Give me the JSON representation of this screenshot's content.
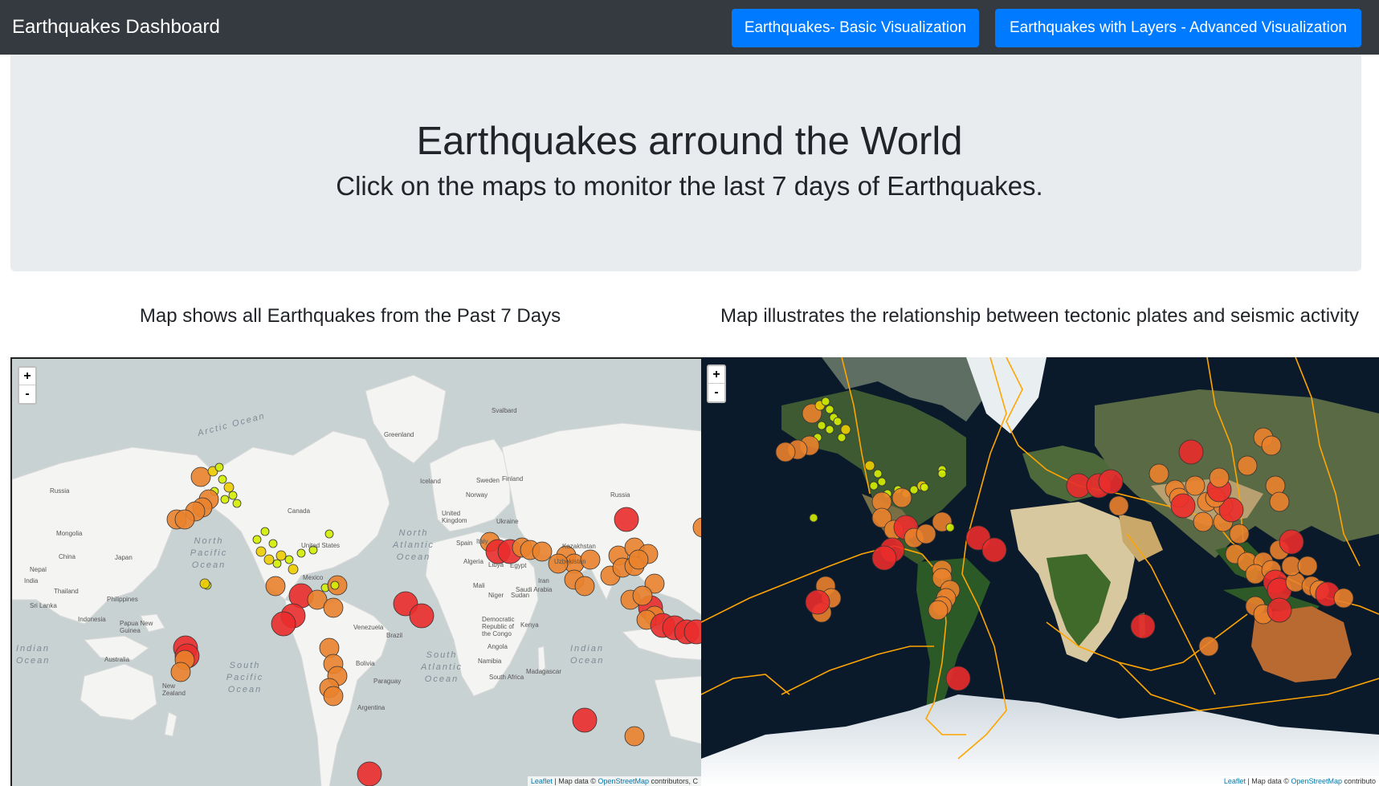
{
  "navbar": {
    "brand": "Earthquakes Dashboard",
    "buttons": [
      {
        "label": "Earthquakes- Basic Visualization"
      },
      {
        "label": "Earthquakes with Layers - Advanced Visualization"
      }
    ]
  },
  "hero": {
    "title": "Earthquakes arround the World",
    "subtitle": "Click on the maps to monitor the last 7 days of Earthquakes."
  },
  "maps": [
    {
      "caption": "Map shows all Earthquakes from the Past 7 Days",
      "zoom_in": "+",
      "zoom_out": "-",
      "attribution": {
        "leaflet": "Leaflet",
        "sep": " | Map data © ",
        "osm": "OpenStreetMap",
        "tail": " contributors, C"
      },
      "ocean_labels": [
        "Arctic Ocean",
        "North Pacific Ocean",
        "North Atlantic Ocean",
        "South Atlantic Ocean",
        "South Pacific Ocean",
        "Indian Ocean",
        "Indian Ocean"
      ],
      "place_labels": [
        "Russia",
        "Mongolia",
        "China",
        "Nepal",
        "India",
        "Thailand",
        "Sri Lanka",
        "Philippines",
        "Indonesia",
        "Papua New Guinea",
        "Australia",
        "New Zealand",
        "Japan",
        "Greenland",
        "Canada",
        "United States",
        "Mexico",
        "Iceland",
        "Sweden",
        "Norway",
        "Finland",
        "United Kingdom",
        "Ukraine",
        "Spain",
        "Italy",
        "Algeria",
        "Libya",
        "Egypt",
        "Mali",
        "Niger",
        "Sudan",
        "Kenya",
        "Democratic Republic of the Congo",
        "Angola",
        "Namibia",
        "South Africa",
        "Madagascar",
        "Brazil",
        "Bolivia",
        "Paraguay",
        "Argentina",
        "Venezuela",
        "Kazakhstan",
        "Uzbekistan",
        "Iran",
        "Saudi Arabia",
        "Svalbard",
        "Russia"
      ]
    },
    {
      "caption": "Map illustrates the relationship between tectonic plates and seismic activity",
      "zoom_in": "+",
      "zoom_out": "-",
      "attribution": {
        "leaflet": "Leaflet",
        "sep": " | Map data © ",
        "osm": "OpenStreetMap",
        "tail": " contributo"
      }
    }
  ],
  "colors": {
    "navbar": "#343a40",
    "button": "#007bff",
    "jumbotron": "#e9ecef",
    "mag_low": "#d4ee00",
    "mag_mid": "#eecc00",
    "mag_high": "#ee9c00",
    "mag_orange": "#ea822c",
    "mag_top": "#ea2c2c",
    "plates": "#ffa500"
  }
}
